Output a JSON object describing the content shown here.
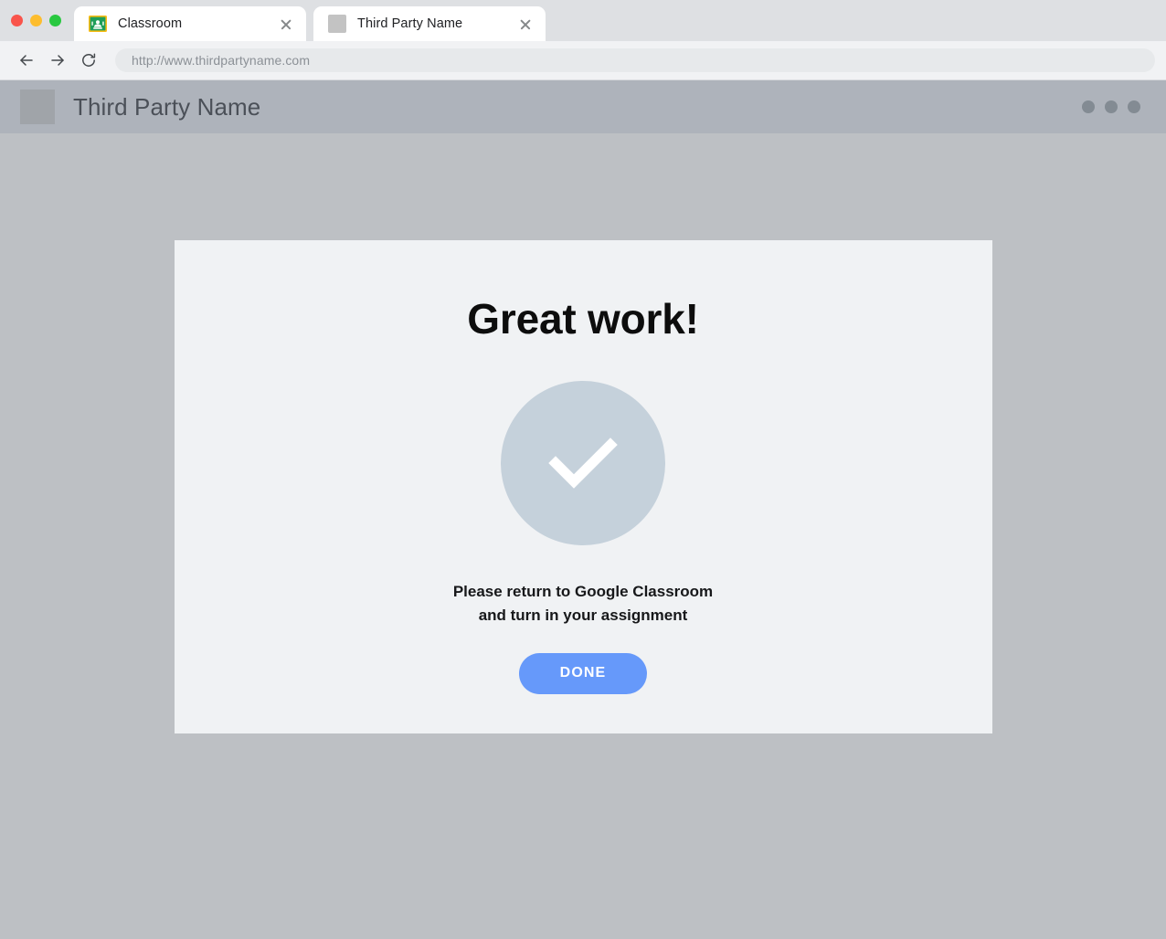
{
  "browser": {
    "window_controls": [
      {
        "name": "close",
        "color": "#f9544b"
      },
      {
        "name": "minimize",
        "color": "#fdbd2e"
      },
      {
        "name": "zoom",
        "color": "#28c840"
      }
    ],
    "tabs": [
      {
        "title": "Classroom",
        "favicon": "google-classroom-icon",
        "active": false
      },
      {
        "title": "Third Party Name",
        "favicon": "placeholder-square-icon",
        "active": true
      }
    ],
    "toolbar": {
      "back_label": "Back",
      "forward_label": "Forward",
      "reload_label": "Reload",
      "address_value": "http://www.thirdpartyname.com"
    }
  },
  "site": {
    "header": {
      "logo": "placeholder-square-logo",
      "title": "Third Party Name",
      "menu_dots": 3
    },
    "card": {
      "headline": "Great work!",
      "status_icon": "checkmark-icon",
      "subtext_line1": "Please return to Google Classroom",
      "subtext_line2": "and turn in your assignment",
      "done_label": "DONE"
    }
  },
  "colors": {
    "page_background": "#bdc0c4",
    "site_header": "#aeb3bb",
    "card_background": "#f0f2f4",
    "accent_button": "#6699fa",
    "check_circle": "#c5d1db",
    "tabstrip": "#dee0e3",
    "toolbar": "#f1f2f4"
  }
}
